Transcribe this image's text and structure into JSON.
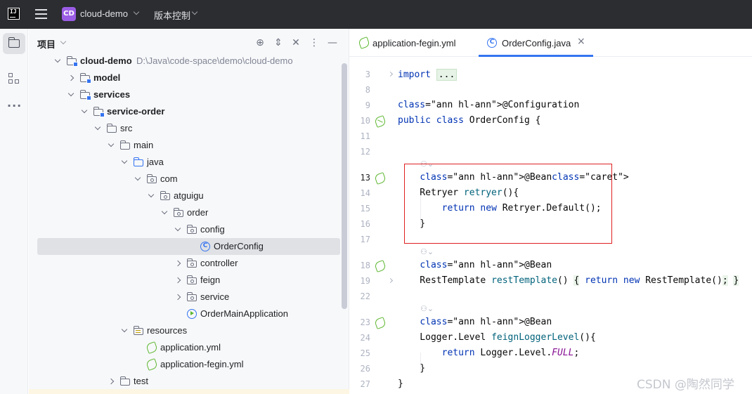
{
  "titlebar": {
    "app_logo": "IJ",
    "project_badge": "CD",
    "project_name": "cloud-demo",
    "vcs_label": "版本控制"
  },
  "panel": {
    "title": "项目"
  },
  "tree": [
    {
      "label": "cloud-demo",
      "path": "D:\\Java\\code-space\\demo\\cloud-demo",
      "depth": 0,
      "icon": "module-folder-icon",
      "expanded": true,
      "bold": true
    },
    {
      "label": "model",
      "depth": 1,
      "icon": "module-folder-icon",
      "expanded": false,
      "bold": true
    },
    {
      "label": "services",
      "depth": 1,
      "icon": "module-folder-icon",
      "expanded": true,
      "bold": true
    },
    {
      "label": "service-order",
      "depth": 2,
      "icon": "module-folder-icon",
      "expanded": true,
      "bold": true
    },
    {
      "label": "src",
      "depth": 3,
      "icon": "folder-icon",
      "expanded": true
    },
    {
      "label": "main",
      "depth": 4,
      "icon": "folder-icon",
      "expanded": true
    },
    {
      "label": "java",
      "depth": 5,
      "icon": "source-folder-icon",
      "expanded": true
    },
    {
      "label": "com",
      "depth": 6,
      "icon": "package-icon",
      "expanded": true
    },
    {
      "label": "atguigu",
      "depth": 7,
      "icon": "package-icon",
      "expanded": true
    },
    {
      "label": "order",
      "depth": 8,
      "icon": "package-icon",
      "expanded": true
    },
    {
      "label": "config",
      "depth": 9,
      "icon": "package-icon",
      "expanded": true
    },
    {
      "label": "OrderConfig",
      "depth": 10,
      "icon": "class-icon",
      "selected": true
    },
    {
      "label": "controller",
      "depth": 9,
      "icon": "package-icon",
      "expanded": false
    },
    {
      "label": "feign",
      "depth": 9,
      "icon": "package-icon",
      "expanded": false
    },
    {
      "label": "service",
      "depth": 9,
      "icon": "package-icon",
      "expanded": false
    },
    {
      "label": "OrderMainApplication",
      "depth": 9,
      "icon": "spring-boot-class-icon"
    },
    {
      "label": "resources",
      "depth": 5,
      "icon": "resources-folder-icon",
      "expanded": true
    },
    {
      "label": "application.yml",
      "depth": 6,
      "icon": "spring-yaml-icon"
    },
    {
      "label": "application-fegin.yml",
      "depth": 6,
      "icon": "spring-yaml-icon"
    },
    {
      "label": "test",
      "depth": 4,
      "icon": "folder-icon",
      "expanded": false
    }
  ],
  "tabs": [
    {
      "label": "application-fegin.yml",
      "icon": "spring-yaml-icon",
      "active": false
    },
    {
      "label": "OrderConfig.java",
      "icon": "class-icon",
      "active": true,
      "close": "×"
    }
  ],
  "editor": {
    "lines": [
      {
        "num": "3",
        "text": "import ..."
      },
      {
        "num": "8",
        "text": ""
      },
      {
        "num": "9",
        "text": "@Configuration"
      },
      {
        "num": "10",
        "text": "public class OrderConfig {"
      },
      {
        "num": "11",
        "text": ""
      },
      {
        "num": "12",
        "text": ""
      },
      {
        "num": "13",
        "text": "    @Bean"
      },
      {
        "num": "14",
        "text": "    Retryer retryer(){"
      },
      {
        "num": "15",
        "text": "        return new Retryer.Default();"
      },
      {
        "num": "16",
        "text": "    }"
      },
      {
        "num": "17",
        "text": ""
      },
      {
        "num": "18",
        "text": "    @Bean"
      },
      {
        "num": "19",
        "text": "    RestTemplate restTemplate() { return new RestTemplate(); }"
      },
      {
        "num": "22",
        "text": ""
      },
      {
        "num": "23",
        "text": "    @Bean"
      },
      {
        "num": "24",
        "text": "    Logger.Level feignLoggerLevel(){"
      },
      {
        "num": "25",
        "text": "        return Logger.Level.FULL;"
      },
      {
        "num": "26",
        "text": "    }"
      },
      {
        "num": "27",
        "text": "}"
      }
    ]
  },
  "watermark": "CSDN @陶然同学",
  "colors": {
    "accent": "#3574f0",
    "keyword": "#0033b3",
    "annotation": "#9e880d",
    "function": "#00627a",
    "highlight_box": "#e02020"
  }
}
